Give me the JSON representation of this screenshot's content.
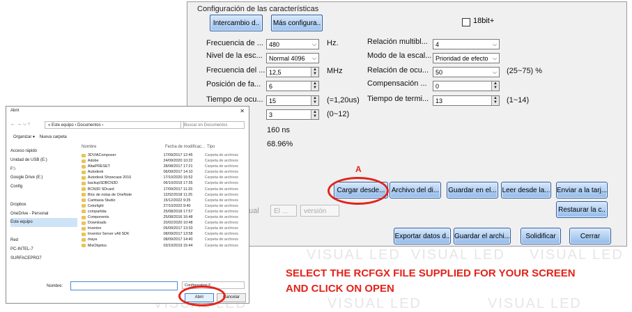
{
  "watermark": "VISUAL LED",
  "config": {
    "section_title": "Configuración de las características",
    "btn_exchange": "Intercambio d..",
    "btn_more": "Más configura..",
    "chk_18bit": "18bit+",
    "rows": [
      {
        "label": "Frecuencia de ...",
        "value": "480",
        "unit": "Hz.",
        "label2": "Relación  multibl...",
        "value2": "4",
        "unit2": ""
      },
      {
        "label": "Nivel de la esc...",
        "value": "Normal 4096",
        "unit": "",
        "label2": "Modo de la escal...",
        "value2": "Prioridad de efecto",
        "unit2": ""
      },
      {
        "label": "Frecuencia del ...",
        "value": "12,5",
        "unit": "MHz",
        "label2": "Relación de ocu...",
        "value2": "50",
        "unit2": "(25~75) %"
      },
      {
        "label": "Posición de fa...",
        "value": "6",
        "unit": "",
        "label2": "Compensación ...",
        "value2": "0",
        "unit2": ""
      },
      {
        "label": "Tiempo de ocu...",
        "value": "15",
        "unit": "(=1,20us)",
        "label2": "Tiempo de termi...",
        "value2": "13",
        "unit2": "(1~14)"
      }
    ],
    "extra_value": "3",
    "extra_unit": "(0~12)",
    "stat1": "160 ns",
    "stat2": "68.96%",
    "btn_load": "Cargar desde...",
    "btn_file": "Archivo del di...",
    "btn_save": "Guardar en el...",
    "btn_read": "Leer desde la...",
    "btn_send": "Enviar a la tarj...",
    "btn_restore": "Restaurar la c..",
    "partial_label": "ual",
    "gray_field1": "El ...",
    "gray_field2": "versión",
    "btn_export": "Exportar datos d..",
    "btn_saveas": "Guardar el archi...",
    "btn_solidify": "Solidificar",
    "btn_close": "Cerrar"
  },
  "annotation": {
    "marker": "A",
    "instruction_line1": "SELECT THE RCFGX FILE SUPPLIED FOR YOUR SCREEN",
    "instruction_line2": "AND CLICK ON OPEN",
    "color": "#e2231a"
  },
  "dialog": {
    "title": "Abrir",
    "breadcrumb": "« Este equipo › Documentos ›",
    "search_placeholder": "Buscar en Documentos",
    "organize": "Organizar ▾",
    "new_folder": "Nueva carpeta",
    "col_name": "Nombre",
    "col_date": "Fecha de modificac...",
    "col_type": "Tipo",
    "sidebar": [
      "Acceso rápido",
      "Unidad de USB (E:)",
      "F:\\",
      "Google Drive (E:)",
      "Config",
      "",
      "Dropbox",
      "OneDrive - Personal",
      "Este equipo",
      "",
      "Red",
      "PC-INTEL-7",
      "SURFACEPRO7"
    ],
    "files": [
      {
        "name": "3DVIAComposer",
        "date": "17/09/2017 12:45",
        "type": "Carpeta de archivos"
      },
      {
        "name": "Adobe",
        "date": "24/09/2020 10:22",
        "type": "Carpeta de archivos"
      },
      {
        "name": "AltaiPRESET",
        "date": "28/08/2017 17:21",
        "type": "Carpeta de archivos"
      },
      {
        "name": "Autodesk",
        "date": "06/09/2017 14:10",
        "type": "Carpeta de archivos"
      },
      {
        "name": "Autodesk Showcase 2016",
        "date": "17/10/2020 16:52",
        "type": "Carpeta de archivos"
      },
      {
        "name": "backupSDBCN3D",
        "date": "06/10/2019 17:35",
        "type": "Carpeta de archivos"
      },
      {
        "name": "BCN3D SDcard",
        "date": "17/09/2017 11:33",
        "type": "Carpeta de archivos"
      },
      {
        "name": "Bloc de notas de OneNote",
        "date": "12/02/2018 11:25",
        "type": "Carpeta de archivos"
      },
      {
        "name": "Camtasia Studio",
        "date": "15/12/2022 9:25",
        "type": "Carpeta de archivos"
      },
      {
        "name": "Celorlight",
        "date": "27/10/2022 9:40",
        "type": "Carpeta de archivos"
      },
      {
        "name": "compartida",
        "date": "25/08/2018 17:57",
        "type": "Carpeta de archivos"
      },
      {
        "name": "Components",
        "date": "25/08/2016 16:48",
        "type": "Carpeta de archivos"
      },
      {
        "name": "Downloads",
        "date": "20/02/2020 10:48",
        "type": "Carpeta de archivos"
      },
      {
        "name": "Inventor",
        "date": "05/09/2017 13:33",
        "type": "Carpeta de archivos"
      },
      {
        "name": "Inventor Server vAll SDK",
        "date": "08/09/2017 13:58",
        "type": "Carpeta de archivos"
      },
      {
        "name": "maya",
        "date": "08/09/2017 14:40",
        "type": "Carpeta de archivos"
      },
      {
        "name": "MisObjetos",
        "date": "03/10/2019 15:44",
        "type": "Carpeta de archivos"
      }
    ],
    "filename_label": "Nombre:",
    "filetype": "Configuration F",
    "open": "Abrir",
    "cancel": "Cancelar"
  }
}
